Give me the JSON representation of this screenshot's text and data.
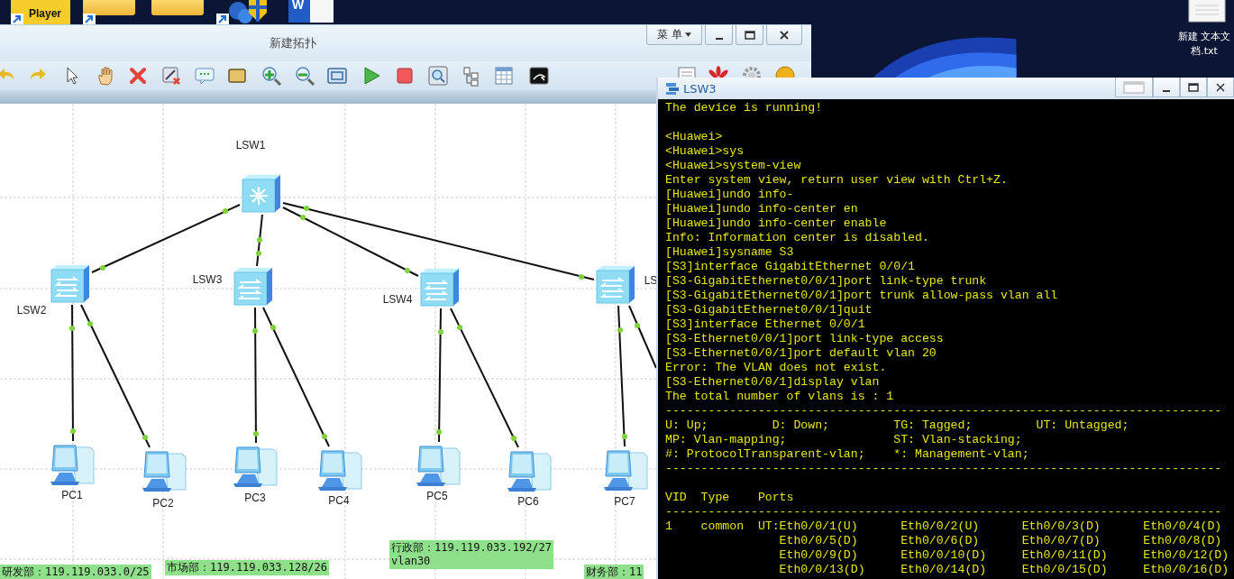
{
  "desktop": {
    "player_label": "Player",
    "word_glyph": "W",
    "file_label_lines": [
      "新建 文本文",
      "档.txt"
    ]
  },
  "topology_window": {
    "title": "新建拓扑",
    "menu_button": "菜 单",
    "nodes": [
      {
        "kind": "core-switch",
        "label": "LSW1"
      },
      {
        "kind": "switch",
        "label": "LSW2"
      },
      {
        "kind": "switch",
        "label": "LSW3"
      },
      {
        "kind": "switch",
        "label": "LSW4"
      },
      {
        "kind": "switch",
        "label": "LS"
      },
      {
        "kind": "pc",
        "label": "PC1"
      },
      {
        "kind": "pc",
        "label": "PC2"
      },
      {
        "kind": "pc",
        "label": "PC3"
      },
      {
        "kind": "pc",
        "label": "PC4"
      },
      {
        "kind": "pc",
        "label": "PC5"
      },
      {
        "kind": "pc",
        "label": "PC6"
      },
      {
        "kind": "pc",
        "label": "PC7"
      }
    ],
    "notes": [
      {
        "lines": [
          "研发部：119.119.033.0/25"
        ]
      },
      {
        "lines": [
          "市场部：119.119.033.128/26"
        ]
      },
      {
        "lines": [
          "行政部：119.119.033.192/27",
          "vlan30"
        ]
      },
      {
        "lines": [
          "财务部：11"
        ]
      }
    ]
  },
  "terminal_window": {
    "title": "LSW3",
    "lines": [
      {
        "kind": "text",
        "text": "The device is running!"
      },
      {
        "kind": "blank"
      },
      {
        "kind": "text",
        "text": "<Huawei>"
      },
      {
        "kind": "text",
        "text": "<Huawei>sys"
      },
      {
        "kind": "text",
        "text": "<Huawei>system-view"
      },
      {
        "kind": "text",
        "text": "Enter system view, return user view with Ctrl+Z."
      },
      {
        "kind": "text",
        "text": "[Huawei]undo info-"
      },
      {
        "kind": "text",
        "text": "[Huawei]undo info-center en"
      },
      {
        "kind": "text",
        "text": "[Huawei]undo info-center enable"
      },
      {
        "kind": "text",
        "text": "Info: Information center is disabled."
      },
      {
        "kind": "text",
        "text": "[Huawei]sysname S3"
      },
      {
        "kind": "text",
        "text": "[S3]interface GigabitEthernet 0/0/1"
      },
      {
        "kind": "text",
        "text": "[S3-GigabitEthernet0/0/1]port link-type trunk"
      },
      {
        "kind": "text",
        "text": "[S3-GigabitEthernet0/0/1]port trunk allow-pass vlan all"
      },
      {
        "kind": "text",
        "text": "[S3-GigabitEthernet0/0/1]quit"
      },
      {
        "kind": "text",
        "text": "[S3]interface Ethernet 0/0/1"
      },
      {
        "kind": "text",
        "text": "[S3-Ethernet0/0/1]port link-type access"
      },
      {
        "kind": "text",
        "text": "[S3-Ethernet0/0/1]port default vlan 20"
      },
      {
        "kind": "text",
        "text": "Error: The VLAN does not exist."
      },
      {
        "kind": "text",
        "text": "[S3-Ethernet0/0/1]display vlan"
      },
      {
        "kind": "text",
        "text": "The total number of vlans is : 1"
      },
      {
        "kind": "text",
        "text": "------------------------------------------------------------------------------"
      },
      {
        "kind": "text",
        "text": "U: Up;         D: Down;         TG: Tagged;         UT: Untagged;"
      },
      {
        "kind": "text",
        "text": "MP: Vlan-mapping;               ST: Vlan-stacking;"
      },
      {
        "kind": "text",
        "text": "#: ProtocolTransparent-vlan;    *: Management-vlan;"
      },
      {
        "kind": "text",
        "text": "------------------------------------------------------------------------------"
      },
      {
        "kind": "blank"
      },
      {
        "kind": "text",
        "text": "VID  Type    Ports"
      },
      {
        "kind": "text",
        "text": "------------------------------------------------------------------------------"
      },
      {
        "kind": "text",
        "text": "1    common  UT:Eth0/0/1(U)      Eth0/0/2(U)      Eth0/0/3(D)      Eth0/0/4(D)"
      },
      {
        "kind": "text",
        "text": "                Eth0/0/5(D)      Eth0/0/6(D)      Eth0/0/7(D)      Eth0/0/8(D)"
      },
      {
        "kind": "text",
        "text": "                Eth0/0/9(D)      Eth0/0/10(D)     Eth0/0/11(D)     Eth0/0/12(D)"
      },
      {
        "kind": "text",
        "text": "                Eth0/0/13(D)     Eth0/0/14(D)     Eth0/0/15(D)     Eth0/0/16(D)"
      }
    ]
  }
}
